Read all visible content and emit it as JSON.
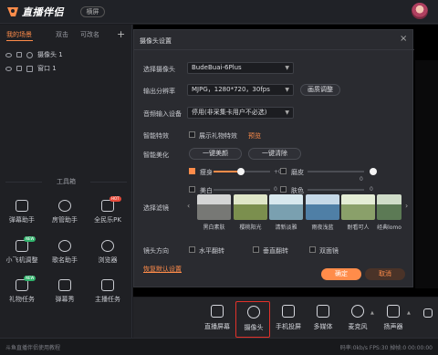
{
  "app": {
    "logo_text": "直播伴侣",
    "mode_pill": "横屏"
  },
  "scenes": {
    "tabs": [
      "我的场景",
      "双击",
      "可改名"
    ],
    "add_label": "+",
    "sources": [
      {
        "label": "摄像头 1"
      },
      {
        "label": "窗口 1"
      }
    ]
  },
  "toolbox": {
    "title": "工具箱",
    "tools": [
      {
        "label": "弹幕助手",
        "icon": "danmaku-icon",
        "tag": ""
      },
      {
        "label": "房管助手",
        "icon": "admin-icon",
        "tag": ""
      },
      {
        "label": "全民乐PK",
        "icon": "pk-icon",
        "tag": "HOT"
      },
      {
        "label": "小飞机调整",
        "icon": "plane-icon",
        "tag": "NEW"
      },
      {
        "label": "歌名助手",
        "icon": "song-icon",
        "tag": ""
      },
      {
        "label": "浏览器",
        "icon": "browser-icon",
        "tag": ""
      },
      {
        "label": "礼物任务",
        "icon": "gift-icon",
        "tag": "NEW"
      },
      {
        "label": "弹幕秀",
        "icon": "danmaku-show-icon",
        "tag": ""
      },
      {
        "label": "主播任务",
        "icon": "task-icon",
        "tag": ""
      }
    ]
  },
  "dialog": {
    "title": "摄像头设置",
    "close_label": "×",
    "camera_label": "选择摄像头",
    "camera_value": "BudeBuai-6Plus",
    "resolution_label": "输出分辨率",
    "resolution_value": "MJPG，1280*720，30fps",
    "resolution_btn": "画质调整",
    "audio_label": "音频输入设备",
    "audio_value": "停用(非采集卡用户不必选)",
    "smart_fx_label": "智能特效",
    "smart_fx_checkbox": "展示礼物特效",
    "smart_fx_preview": "预览",
    "beauty_label": "智能美化",
    "beauty_one_click": "一键美颜",
    "beauty_clear": "一键清除",
    "adjust": [
      {
        "label": "瘦身",
        "checked": true,
        "value": "+0",
        "level": 0.45
      },
      {
        "label": "磨皮",
        "checked": false,
        "value": "0",
        "level": 0.0
      },
      {
        "label": "美白",
        "checked": false,
        "value": "0",
        "level": 0.0
      },
      {
        "label": "肤色",
        "checked": false,
        "value": "0",
        "level": 0.0
      }
    ],
    "filter_label": "选择滤镜",
    "filters": [
      {
        "label": "黑白素肤",
        "color": "#6f7d5a"
      },
      {
        "label": "樱桃阳光",
        "color": "#7b8f4e"
      },
      {
        "label": "清新淡雅",
        "color": "#7aa0b0"
      },
      {
        "label": "雨夜浅蓝",
        "color": "#4f7fa6"
      },
      {
        "label": "耐看可人",
        "color": "#8aa06a"
      },
      {
        "label": "经典lomo",
        "color": "#5c7a55"
      },
      {
        "label": "紫色迷情",
        "color": "#8a7aa8"
      }
    ],
    "mirror_label": "镜头方向",
    "mirror_options": [
      "水平翻转",
      "垂直翻转",
      "双面镜"
    ],
    "restore_default": "恢复默认设置",
    "ok": "确定",
    "cancel": "取消"
  },
  "bottom_bar": {
    "items": [
      {
        "label": "直播屏幕",
        "icon": "screen-icon"
      },
      {
        "label": "摄像头",
        "icon": "camera-icon"
      },
      {
        "label": "手机投屏",
        "icon": "phone-cast-icon"
      },
      {
        "label": "多媒体",
        "icon": "media-icon"
      },
      {
        "label": "麦克风",
        "icon": "microphone-icon"
      },
      {
        "label": "扬声器",
        "icon": "speaker-icon"
      }
    ]
  },
  "status": {
    "help": "斗鱼直播伴侣使用教程",
    "right": "码率:0kb/s   FPS:30   掉帧:0 00:00:00"
  },
  "colors": {
    "accent": "#ff8c4a",
    "selected_border": "#e2322a"
  }
}
